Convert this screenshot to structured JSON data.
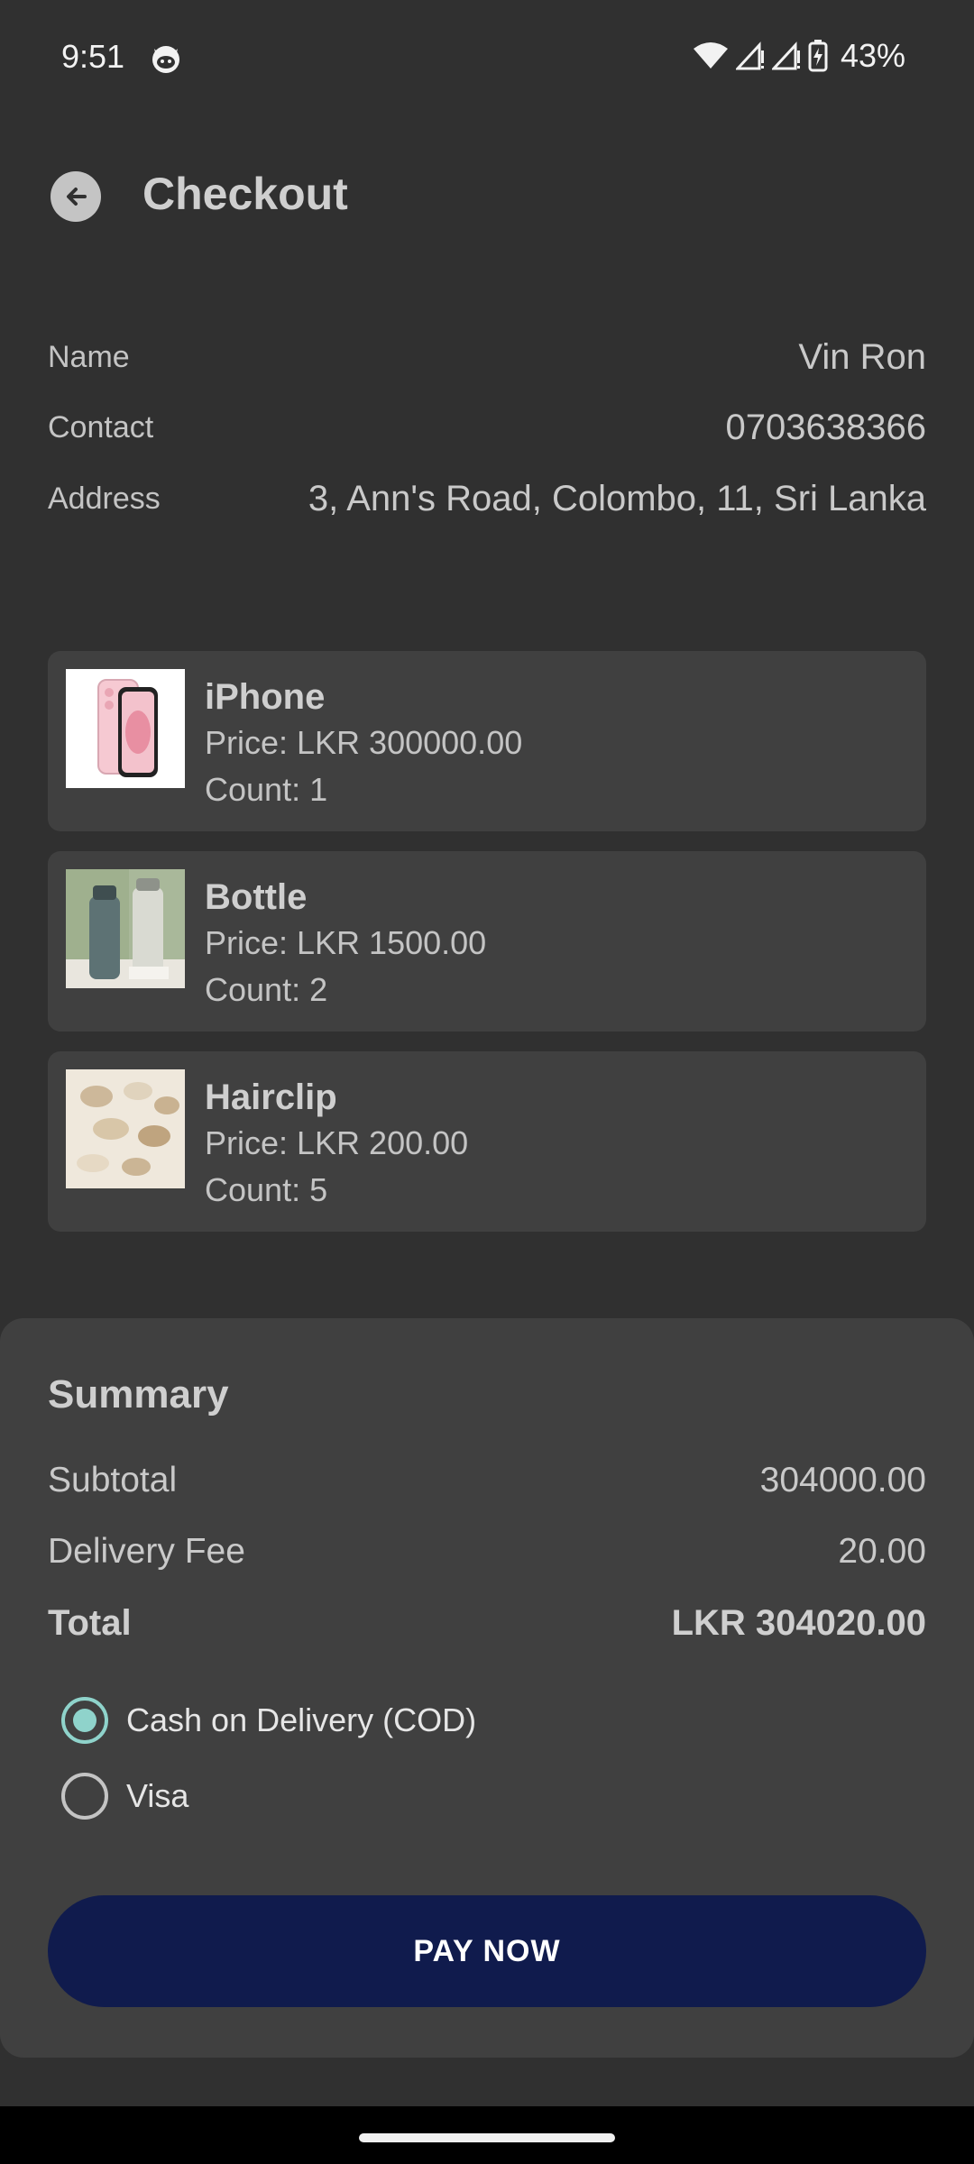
{
  "status_bar": {
    "time": "9:51",
    "battery": "43%"
  },
  "header": {
    "title": "Checkout"
  },
  "customer": {
    "rows": [
      {
        "label": "Name",
        "value": "Vin Ron"
      },
      {
        "label": "Contact",
        "value": "0703638366"
      },
      {
        "label": "Address",
        "value": "3, Ann's Road, Colombo, 11, Sri Lanka"
      }
    ]
  },
  "cart": {
    "items": [
      {
        "name": "iPhone",
        "price": "Price: LKR 300000.00",
        "count": "Count: 1"
      },
      {
        "name": "Bottle",
        "price": "Price: LKR 1500.00",
        "count": "Count: 2"
      },
      {
        "name": "Hairclip",
        "price": "Price: LKR 200.00",
        "count": "Count: 5"
      }
    ]
  },
  "summary": {
    "title": "Summary",
    "subtotal_label": "Subtotal",
    "subtotal_value": "304000.00",
    "delivery_label": "Delivery Fee",
    "delivery_value": "20.00",
    "total_label": "Total",
    "total_value": "LKR 304020.00"
  },
  "payment": {
    "options": [
      {
        "label": "Cash on Delivery (COD)",
        "selected": true
      },
      {
        "label": "Visa",
        "selected": false
      }
    ],
    "pay_button": "PAY NOW"
  },
  "colors": {
    "background": "#303030",
    "card": "#404040",
    "accent": "#8fd3cb",
    "button": "#101b4d"
  }
}
